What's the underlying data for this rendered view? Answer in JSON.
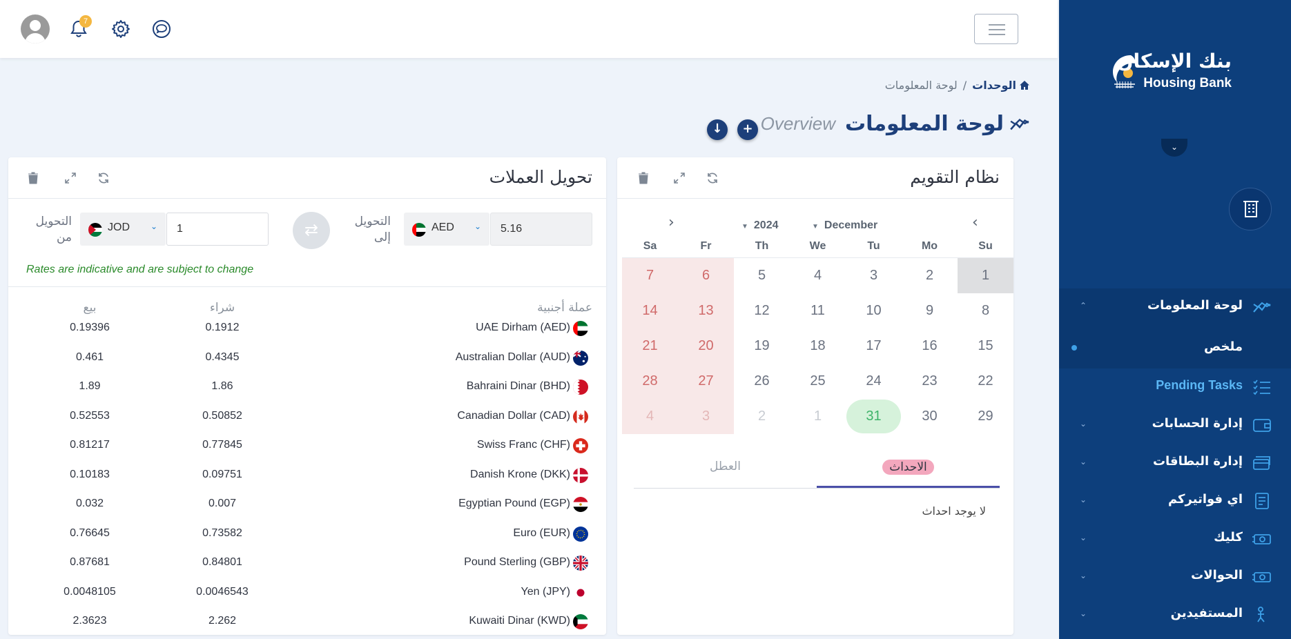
{
  "header": {
    "notification_count": "7"
  },
  "sidebar": {
    "logo_ar": "بنك الإسكان",
    "logo_en": "Housing Bank",
    "items": [
      {
        "label": "لوحة المعلومات",
        "icon": "chart-line-icon",
        "active": true
      },
      {
        "label": "ملخص",
        "sub": true
      },
      {
        "label": "Pending Tasks",
        "icon": "tasks-icon"
      },
      {
        "label": "إدارة الحسابات",
        "icon": "wallet-icon"
      },
      {
        "label": "إدارة البطاقات",
        "icon": "credit-card-icon"
      },
      {
        "label": "اي فواتيركم",
        "icon": "invoice-icon"
      },
      {
        "label": "كليك",
        "icon": "cash-icon"
      },
      {
        "label": "الحوالات",
        "icon": "transfer-icon"
      },
      {
        "label": "المستفيدين",
        "icon": "beneficiaries-icon"
      }
    ]
  },
  "breadcrumb": {
    "home": "الوحدات",
    "separator": "/",
    "current": "لوحة المعلومات"
  },
  "page": {
    "title_ar": "لوحة المعلومات",
    "title_en": "Overview"
  },
  "calendar": {
    "title": "نظام التقويم",
    "year": "2024",
    "month": "December",
    "days_of_week": [
      "Su",
      "Mo",
      "Tu",
      "We",
      "Th",
      "Fr",
      "Sa"
    ],
    "weeks": [
      [
        "1",
        "2",
        "3",
        "4",
        "5",
        "6",
        "7"
      ],
      [
        "8",
        "9",
        "10",
        "11",
        "12",
        "13",
        "14"
      ],
      [
        "15",
        "16",
        "17",
        "18",
        "19",
        "20",
        "21"
      ],
      [
        "22",
        "23",
        "24",
        "25",
        "26",
        "27",
        "28"
      ],
      [
        "29",
        "30",
        "31",
        "1",
        "2",
        "3",
        "4"
      ]
    ],
    "tabs": {
      "events": "الاحداث",
      "holidays": "العطل"
    },
    "no_events": "لا يوجد احداث"
  },
  "converter": {
    "title": "تحويل العملات",
    "from_label": "التحويل من",
    "to_label": "التحويل إلى",
    "from_currency": "JOD",
    "from_amount": "1",
    "to_currency": "AED",
    "to_amount": "5.16",
    "note": "Rates are indicative and are subject to change",
    "headers": {
      "currency": "عملة أجنبية",
      "buy": "شراء",
      "sell": "بيع"
    },
    "rates": [
      {
        "name": "UAE Dirham (AED)",
        "buy": "0.1912",
        "sell": "0.19396"
      },
      {
        "name": "Australian Dollar (AUD)",
        "buy": "0.4345",
        "sell": "0.461"
      },
      {
        "name": "Bahraini Dinar (BHD)",
        "buy": "1.86",
        "sell": "1.89"
      },
      {
        "name": "Canadian Dollar (CAD)",
        "buy": "0.50852",
        "sell": "0.52553"
      },
      {
        "name": "Swiss Franc (CHF)",
        "buy": "0.77845",
        "sell": "0.81217"
      },
      {
        "name": "Danish Krone (DKK)",
        "buy": "0.09751",
        "sell": "0.10183"
      },
      {
        "name": "Egyptian Pound (EGP)",
        "buy": "0.007",
        "sell": "0.032"
      },
      {
        "name": "Euro (EUR)",
        "buy": "0.73582",
        "sell": "0.76645"
      },
      {
        "name": "Pound Sterling (GBP)",
        "buy": "0.84801",
        "sell": "0.87681"
      },
      {
        "name": "Yen (JPY)",
        "buy": "0.0046543",
        "sell": "0.0048105"
      },
      {
        "name": "Kuwaiti Dinar (KWD)",
        "buy": "2.262",
        "sell": "2.3623"
      }
    ]
  },
  "colors": {
    "brand_navy": "#0d3f7c",
    "accent_blue": "#3ea1e8",
    "weekend_bg": "#f8e8e8",
    "today_green": "#3fb46a",
    "note_green": "#2a8a2a"
  }
}
